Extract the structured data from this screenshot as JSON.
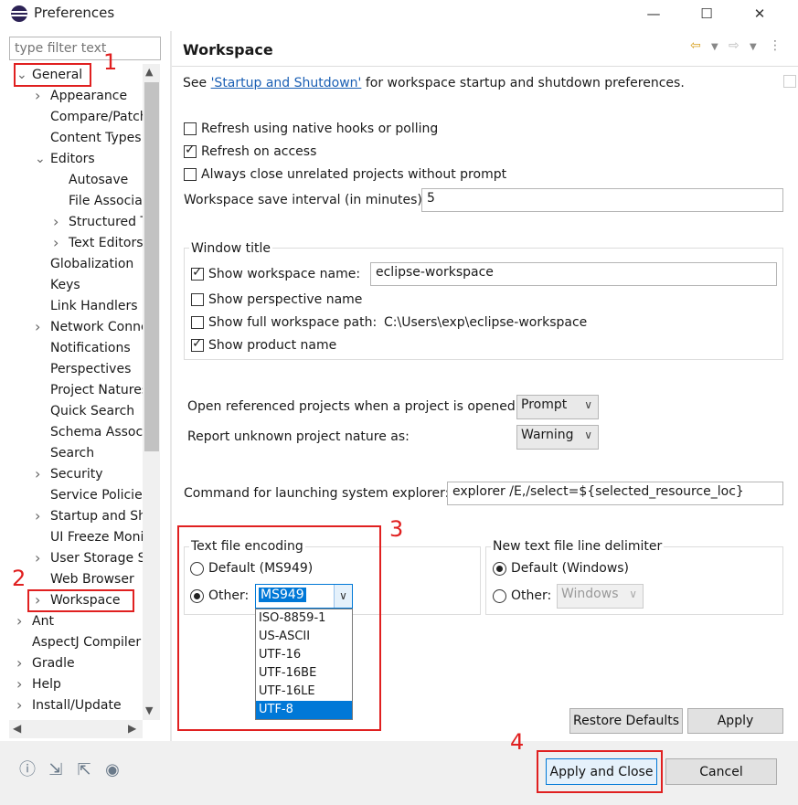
{
  "window": {
    "title": "Preferences"
  },
  "filter": {
    "placeholder": "type filter text"
  },
  "tree": [
    {
      "label": "General",
      "twisty": "v",
      "indent": 0
    },
    {
      "label": "Appearance",
      "twisty": ">",
      "indent": 1
    },
    {
      "label": "Compare/Patch",
      "twisty": "",
      "indent": 1
    },
    {
      "label": "Content Types",
      "twisty": "",
      "indent": 1
    },
    {
      "label": "Editors",
      "twisty": "v",
      "indent": 1
    },
    {
      "label": "Autosave",
      "twisty": "",
      "indent": 2
    },
    {
      "label": "File Associations",
      "twisty": "",
      "indent": 2
    },
    {
      "label": "Structured Text",
      "twisty": ">",
      "indent": 2
    },
    {
      "label": "Text Editors",
      "twisty": ">",
      "indent": 2
    },
    {
      "label": "Globalization",
      "twisty": "",
      "indent": 1
    },
    {
      "label": "Keys",
      "twisty": "",
      "indent": 1
    },
    {
      "label": "Link Handlers",
      "twisty": "",
      "indent": 1
    },
    {
      "label": "Network Connections",
      "twisty": ">",
      "indent": 1
    },
    {
      "label": "Notifications",
      "twisty": "",
      "indent": 1
    },
    {
      "label": "Perspectives",
      "twisty": "",
      "indent": 1
    },
    {
      "label": "Project Natures",
      "twisty": "",
      "indent": 1
    },
    {
      "label": "Quick Search",
      "twisty": "",
      "indent": 1
    },
    {
      "label": "Schema Associations",
      "twisty": "",
      "indent": 1
    },
    {
      "label": "Search",
      "twisty": "",
      "indent": 1
    },
    {
      "label": "Security",
      "twisty": ">",
      "indent": 1
    },
    {
      "label": "Service Policies",
      "twisty": "",
      "indent": 1
    },
    {
      "label": "Startup and Shutdown",
      "twisty": ">",
      "indent": 1
    },
    {
      "label": "UI Freeze Monitoring",
      "twisty": "",
      "indent": 1
    },
    {
      "label": "User Storage Service",
      "twisty": ">",
      "indent": 1
    },
    {
      "label": "Web Browser",
      "twisty": "",
      "indent": 1
    },
    {
      "label": "Workspace",
      "twisty": ">",
      "indent": 1
    },
    {
      "label": "Ant",
      "twisty": ">",
      "indent": 0
    },
    {
      "label": "AspectJ Compiler",
      "twisty": "",
      "indent": 0
    },
    {
      "label": "Gradle",
      "twisty": ">",
      "indent": 0
    },
    {
      "label": "Help",
      "twisty": ">",
      "indent": 0
    },
    {
      "label": "Install/Update",
      "twisty": ">",
      "indent": 0
    }
  ],
  "page": {
    "title": "Workspace",
    "see_prefix": "See ",
    "see_link": "'Startup and Shutdown'",
    "see_suffix": " for workspace startup and shutdown preferences.",
    "refresh_native": {
      "label": "Refresh using native hooks or polling",
      "checked": false
    },
    "refresh_access": {
      "label": "Refresh on access",
      "checked": true
    },
    "always_close": {
      "label": "Always close unrelated projects without prompt",
      "checked": false
    },
    "save_interval": {
      "label": "Workspace save interval (in minutes):",
      "value": "5"
    },
    "window_title": {
      "group_label": "Window title",
      "show_workspace_name": {
        "label": "Show workspace name:",
        "checked": true,
        "value": "eclipse-workspace"
      },
      "show_perspective_name": {
        "label": "Show perspective name",
        "checked": false
      },
      "show_full_path": {
        "label": "Show full workspace path:",
        "checked": false,
        "value": "C:\\Users\\exp\\eclipse-workspace"
      },
      "show_product_name": {
        "label": "Show product name",
        "checked": true
      }
    },
    "open_referenced": {
      "label": "Open referenced projects when a project is opened:",
      "value": "Prompt"
    },
    "report_unknown": {
      "label": "Report unknown project nature as:",
      "value": "Warning"
    },
    "explorer_cmd": {
      "label": "Command for launching system explorer:",
      "value": "explorer /E,/select=${selected_resource_loc}"
    },
    "encoding": {
      "group_label": "Text file encoding",
      "default_label": "Default (MS949)",
      "other_label": "Other:",
      "other_value": "MS949",
      "options": [
        "ISO-8859-1",
        "US-ASCII",
        "UTF-16",
        "UTF-16BE",
        "UTF-16LE",
        "UTF-8"
      ],
      "highlighted": "UTF-8"
    },
    "delimiter": {
      "group_label": "New text file line delimiter",
      "default_label": "Default (Windows)",
      "other_label": "Other:",
      "other_value": "Windows"
    },
    "restore_defaults": "Restore Defaults",
    "apply": "Apply"
  },
  "footer": {
    "apply_close": "Apply and Close",
    "cancel": "Cancel"
  },
  "annotations": [
    "1",
    "2",
    "3",
    "4"
  ],
  "colors": {
    "annotation": "#e02020",
    "selection": "#0078d7",
    "link": "#1a5fb4"
  }
}
